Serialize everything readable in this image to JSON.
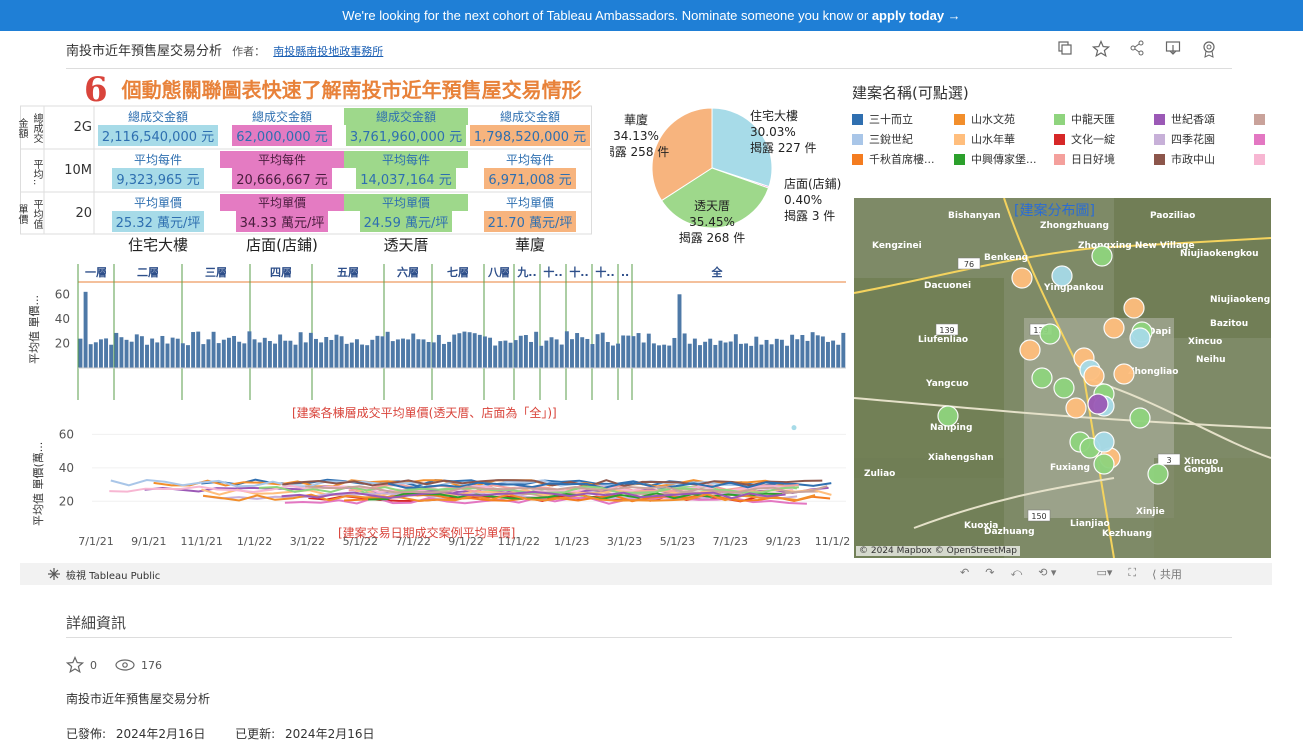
{
  "banner": {
    "text": "We're looking for the next cohort of Tableau Ambassadors. Nominate someone you know or",
    "cta": "apply today →"
  },
  "header": {
    "title": "南投市近年預售屋交易分析",
    "by": "作者：",
    "author": "南投縣南投地政事務所"
  },
  "toolbar_icons": [
    "copy-icon",
    "star-icon",
    "share-icon",
    "download-icon",
    "badge-icon"
  ],
  "viz": {
    "big_title_num": "6",
    "big_title": "個動態關聯圖表快速了解南投市近年預售屋交易情形",
    "kpi": {
      "row_labels": [
        "總成交金額",
        "平均每件",
        "平均單價"
      ],
      "row_axis_labels": [
        "總成交\n金額",
        "平均..",
        "平均值\n單價"
      ],
      "row_ticks": [
        "2G",
        "10M",
        "20"
      ],
      "columns": [
        "住宅大樓",
        "店面(店鋪)",
        "透天厝",
        "華廈"
      ],
      "colors": [
        "#a7dbe8",
        "#e47bc2",
        "#9ed88b",
        "#f7b47e"
      ],
      "total": [
        "2,116,540,000 元",
        "62,000,000 元",
        "3,761,960,000 元",
        "1,798,520,000 元"
      ],
      "avg_each": [
        "9,323,965 元",
        "20,666,667 元",
        "14,037,164 元",
        "6,971,008 元"
      ],
      "avg_price": [
        "25.32 萬元/坪",
        "34.33 萬元/坪",
        "24.59 萬元/坪",
        "21.70 萬元/坪"
      ],
      "label_total": "總成交金額",
      "label_each": "平均每件",
      "label_price": "平均單價"
    },
    "pie": {
      "slices": [
        {
          "name": "住宅大樓",
          "pct": 30.03,
          "label1": "住宅大樓",
          "label2": "30.03%",
          "label3": "揭露 227 件",
          "color": "#a7dbe8"
        },
        {
          "name": "店面(店鋪)",
          "pct": 0.4,
          "label1": "店面(店鋪)",
          "label2": "0.40%",
          "label3": "揭露 3 件",
          "color": "#e47bc2"
        },
        {
          "name": "透天厝",
          "pct": 35.45,
          "label1": "透天厝",
          "label2": "35.45%",
          "label3": "揭露 268 件",
          "color": "#9ed88b"
        },
        {
          "name": "華廈",
          "pct": 34.13,
          "label1": "華廈",
          "label2": "34.13%",
          "label3": "揭露 258 件",
          "color": "#f7b47e"
        }
      ]
    },
    "floor_chart": {
      "floors": [
        "一層",
        "二層",
        "三層",
        "四層",
        "五層",
        "六層",
        "七層",
        "八層",
        "九..",
        "十..",
        "十..",
        "十..",
        "..",
        "全"
      ],
      "yticks": [
        "60",
        "40",
        "20"
      ],
      "ylabel": "平均值 單價...",
      "caption": "[建案各棟層成交平均單價(透天厝、店面為「全」)]"
    },
    "line_chart": {
      "yticks": [
        "60",
        "40",
        "20"
      ],
      "ylabel": "平均值 單價(萬...",
      "xticks": [
        "7/1/21",
        "9/1/21",
        "11/1/21",
        "1/1/22",
        "3/1/22",
        "5/1/22",
        "7/1/22",
        "9/1/22",
        "11/1/22",
        "1/1/23",
        "3/1/23",
        "5/1/23",
        "7/1/23",
        "9/1/23",
        "11/1/23"
      ],
      "caption": "[建案交易日期成交案例平均單價]"
    },
    "legend": {
      "title": "建案名稱(可點選)",
      "items": [
        {
          "name": "三十而立",
          "color": "#2f6fb0"
        },
        {
          "name": "山水文苑",
          "color": "#f28e2b"
        },
        {
          "name": "中龍天匯",
          "color": "#8fd47e"
        },
        {
          "name": "世紀香頌",
          "color": "#9b59b6"
        },
        {
          "name": "",
          "color": "#c9a29a"
        },
        {
          "name": "三銳世紀",
          "color": "#a9c6e8"
        },
        {
          "name": "山水年華",
          "color": "#ffbe7d"
        },
        {
          "name": "文化一綻",
          "color": "#d62728"
        },
        {
          "name": "四季花園",
          "color": "#c7b0d8"
        },
        {
          "name": "",
          "color": "#e377c2"
        },
        {
          "name": "千秋首席樓...",
          "color": "#f47c20"
        },
        {
          "name": "中興傳家堡...",
          "color": "#2ca02c"
        },
        {
          "name": "日日好境",
          "color": "#f4a09c"
        },
        {
          "name": "市政中山",
          "color": "#8c564b"
        },
        {
          "name": "",
          "color": "#f7b6d2"
        }
      ]
    },
    "map": {
      "title": "[建案分布圖]",
      "attribution": "© 2024 Mapbox  © OpenStreetMap",
      "places": [
        "Bishanyan",
        "Zhongzhuang",
        "Zhongxing New Village",
        "Paoziliao",
        "Kengzinei",
        "Benkeng",
        "Niujiaokengkou",
        "Dacuonei",
        "Yingpankou",
        "Niujiaokeng",
        "Bazitou",
        "Liufenliao",
        "Dapi",
        "Xincuo",
        "Yangcuo",
        "Neihu",
        "Nanping",
        "Xiahengshan",
        "Zhongliao",
        "Gongbu",
        "Xincuo",
        "Kuoxia",
        "Dazhuang",
        "Xinjie",
        "Lianjiao",
        "Kezhuang",
        "Fuxiang",
        "Zuliao"
      ],
      "road_labels": [
        "76",
        "139",
        "139",
        "150",
        "3"
      ]
    }
  },
  "bottombar": {
    "tableau_public": "檢視 Tableau Public",
    "share": "共用"
  },
  "details": {
    "title": "詳細資訊",
    "stars": "0",
    "views": "176",
    "description": "南投市近年預售屋交易分析",
    "published_label": "已發佈:",
    "published": "2024年2月16日",
    "updated_label": "已更新:",
    "updated": "2024年2月16日"
  }
}
